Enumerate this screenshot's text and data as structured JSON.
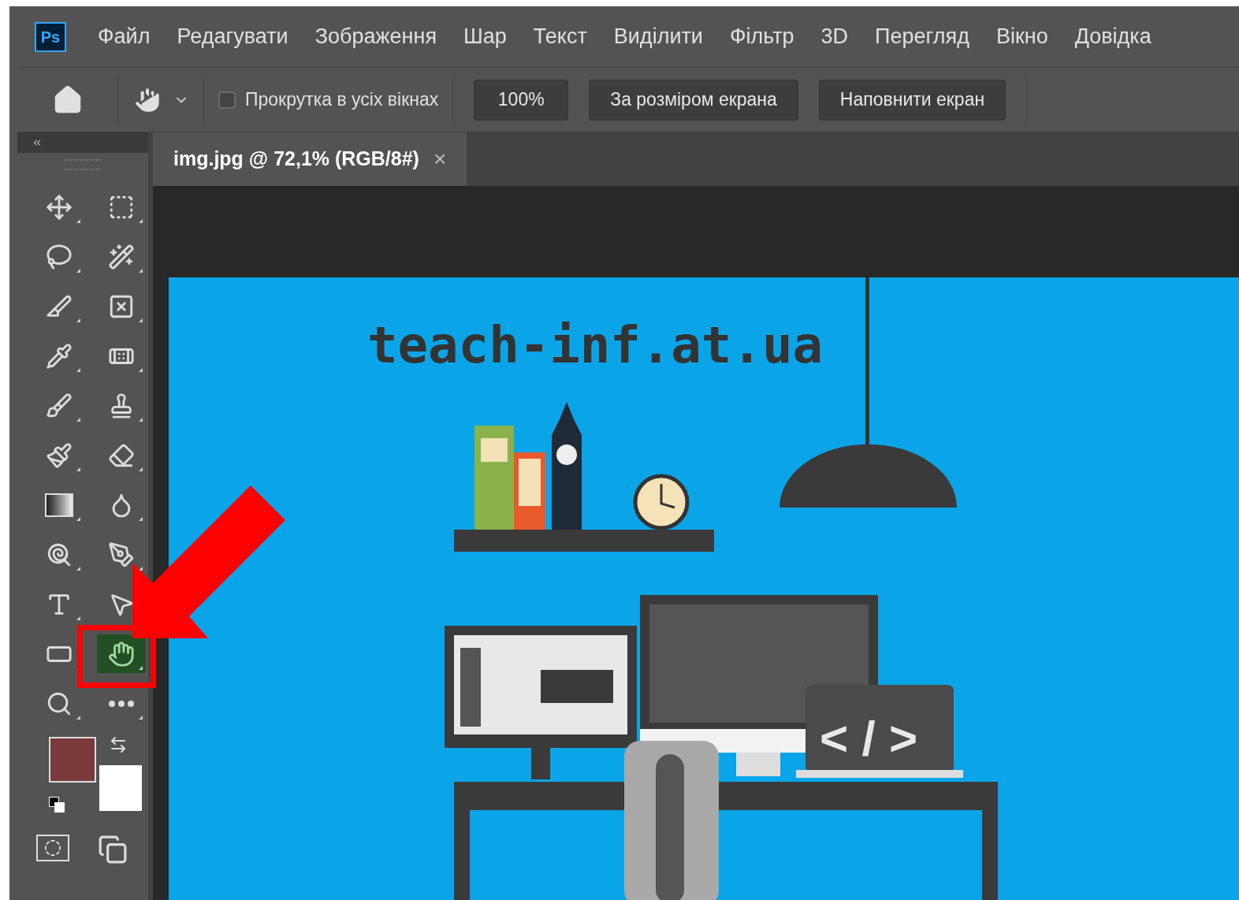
{
  "app": {
    "logo": "Ps"
  },
  "menu": [
    "Файл",
    "Редагувати",
    "Зображення",
    "Шар",
    "Текст",
    "Виділити",
    "Фільтр",
    "3D",
    "Перегляд",
    "Вікно",
    "Довідка"
  ],
  "options": {
    "scroll_all": {
      "label": "Прокрутка в усіх вікнах",
      "checked": false
    },
    "buttons": [
      "100%",
      "За розміром екрана",
      "Наповнити екран"
    ]
  },
  "tabs": [
    {
      "label": "img.jpg @ 72,1% (RGB/8#)",
      "selected": true,
      "close": "×"
    }
  ],
  "tools": [
    {
      "selected": false
    },
    {
      "selected": false
    },
    {
      "selected": false
    },
    {
      "selected": false
    },
    {
      "selected": false
    },
    {
      "selected": false
    },
    {
      "selected": false
    },
    {
      "selected": false
    },
    {
      "selected": false
    },
    {
      "selected": false
    },
    {
      "selected": false
    },
    {
      "selected": false
    },
    {
      "selected": false
    },
    {
      "selected": false
    },
    {
      "selected": false
    },
    {
      "selected": false
    },
    {
      "selected": false
    },
    {
      "selected": false
    },
    {
      "selected": false
    },
    {
      "selected": true
    },
    {
      "selected": false
    },
    {
      "selected": false
    }
  ],
  "image": {
    "title": "teach-inf.at.ua",
    "code_sign": "< / >"
  }
}
